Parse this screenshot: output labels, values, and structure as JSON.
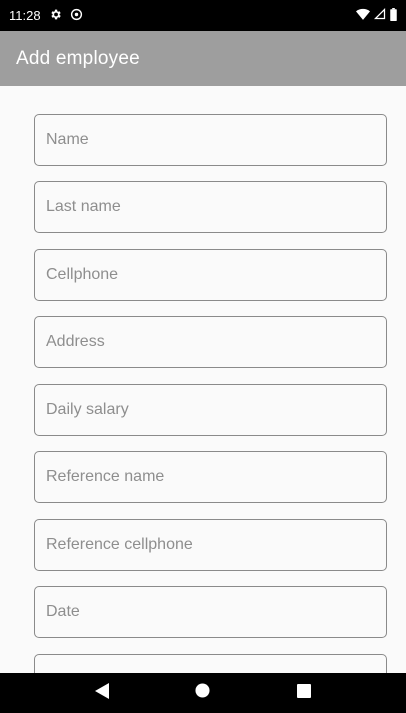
{
  "status_bar": {
    "time": "11:28",
    "icons_left": [
      "gear-icon",
      "at-sign-icon"
    ],
    "icons_right": [
      "wifi-icon",
      "cell-signal-icon",
      "battery-icon"
    ]
  },
  "app_bar": {
    "title": "Add employee",
    "color": "#9e9e9e"
  },
  "form": {
    "fields": [
      {
        "placeholder": "Name",
        "value": ""
      },
      {
        "placeholder": "Last name",
        "value": ""
      },
      {
        "placeholder": "Cellphone",
        "value": ""
      },
      {
        "placeholder": "Address",
        "value": ""
      },
      {
        "placeholder": "Daily salary",
        "value": ""
      },
      {
        "placeholder": "Reference name",
        "value": ""
      },
      {
        "placeholder": "Reference cellphone",
        "value": ""
      },
      {
        "placeholder": "Date",
        "value": ""
      },
      {
        "placeholder": "",
        "value": ""
      }
    ]
  },
  "nav_bar": {
    "buttons": [
      "back-icon",
      "home-icon",
      "recents-icon"
    ]
  }
}
